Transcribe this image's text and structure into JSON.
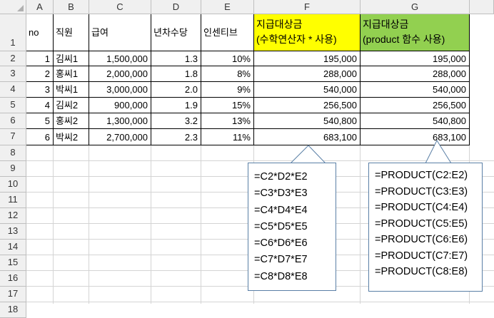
{
  "sheet": {
    "columns": [
      "A",
      "B",
      "C",
      "D",
      "E",
      "F",
      "G"
    ],
    "row_numbers": [
      "1",
      "2",
      "3",
      "4",
      "5",
      "6",
      "7",
      "8",
      "9",
      "10",
      "11",
      "12",
      "13",
      "14",
      "15",
      "16",
      "17",
      "18"
    ],
    "header": {
      "no": "no",
      "employee": "직원",
      "salary": "급여",
      "seniority": "년차수당",
      "incentive": "인센티브",
      "pay_arith_line1": "지급대상금",
      "pay_arith_line2": "(수학연산자 * 사용)",
      "pay_product_line1": "지급대상금",
      "pay_product_line2": "(product 함수 사용)"
    },
    "rows": [
      {
        "no": "1",
        "name": "김씨1",
        "salary": "1,500,000",
        "seniority": "1.3",
        "incentive": "10%",
        "arith": "195,000",
        "product": "195,000"
      },
      {
        "no": "2",
        "name": "홍씨1",
        "salary": "2,000,000",
        "seniority": "1.8",
        "incentive": "8%",
        "arith": "288,000",
        "product": "288,000"
      },
      {
        "no": "3",
        "name": "박씨1",
        "salary": "3,000,000",
        "seniority": "2.0",
        "incentive": "9%",
        "arith": "540,000",
        "product": "540,000"
      },
      {
        "no": "4",
        "name": "김씨2",
        "salary": "900,000",
        "seniority": "1.9",
        "incentive": "15%",
        "arith": "256,500",
        "product": "256,500"
      },
      {
        "no": "5",
        "name": "홍씨2",
        "salary": "1,300,000",
        "seniority": "3.2",
        "incentive": "13%",
        "arith": "540,800",
        "product": "540,800"
      },
      {
        "no": "6",
        "name": "박씨2",
        "salary": "2,700,000",
        "seniority": "2.3",
        "incentive": "11%",
        "arith": "683,100",
        "product": "683,100"
      }
    ]
  },
  "callouts": {
    "arith": [
      "=C2*D2*E2",
      "=C3*D3*E3",
      "=C4*D4*E4",
      "=C5*D5*E5",
      "=C6*D6*E6",
      "=C7*D7*E7",
      "=C8*D8*E8"
    ],
    "product": [
      "=PRODUCT(C2:E2)",
      "=PRODUCT(C3:E3)",
      "=PRODUCT(C4:E4)",
      "=PRODUCT(C5:E5)",
      "=PRODUCT(C6:E6)",
      "=PRODUCT(C7:E7)",
      "=PRODUCT(C8:E8)"
    ]
  },
  "colors": {
    "yellow_header": "#ffff00",
    "green_header": "#92d050",
    "callout_border": "#5a7fa6",
    "header_gray": "#f0f0f0"
  }
}
